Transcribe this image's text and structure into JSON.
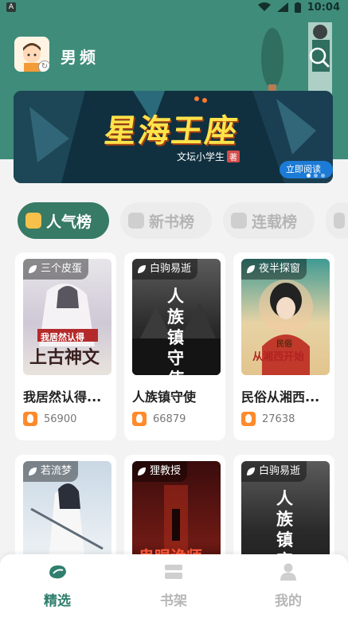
{
  "status_bar": {
    "time": "10:04",
    "app_badge": "A"
  },
  "header": {
    "title": "男频",
    "search_icon": "search-icon"
  },
  "banner": {
    "title": "星海王座",
    "author": "文坛小学生",
    "author_tag": "著",
    "read_button": "立即阅读 ▸",
    "dots_total": 3,
    "active_dot": 1
  },
  "tabs": [
    {
      "label": "人气榜",
      "active": true
    },
    {
      "label": "新书榜",
      "active": false
    },
    {
      "label": "连载榜",
      "active": false
    }
  ],
  "books": [
    {
      "author": "三个皮蛋",
      "title": "我居然认得...",
      "count": "56900",
      "cover_text": "上古神文",
      "cover_subtext": "我居然认得"
    },
    {
      "author": "白驹易逝",
      "title": "人族镇守使",
      "count": "66879",
      "cover_text": "人族镇守使",
      "cover_subtext": ""
    },
    {
      "author": "夜半探窗",
      "title": "民俗从湘西...",
      "count": "27638",
      "cover_text": "从湘西开始",
      "cover_subtext": "民俗"
    },
    {
      "author": "若流梦",
      "title": "",
      "count": "",
      "cover_text": "",
      "cover_subtext": ""
    },
    {
      "author": "狸教授",
      "title": "",
      "count": "",
      "cover_text": "鬼眼诡师",
      "cover_subtext": ""
    },
    {
      "author": "白驹易逝",
      "title": "",
      "count": "",
      "cover_text": "人族镇守",
      "cover_subtext": ""
    }
  ],
  "bottom_nav": [
    {
      "label": "精选",
      "active": true,
      "icon": "featured-icon"
    },
    {
      "label": "书架",
      "active": false,
      "icon": "bookshelf-icon"
    },
    {
      "label": "我的",
      "active": false,
      "icon": "profile-icon"
    }
  ],
  "colors": {
    "primary": "#377a66",
    "header_bg": "#3f8c7a",
    "accent_orange": "#ff8a2b"
  }
}
